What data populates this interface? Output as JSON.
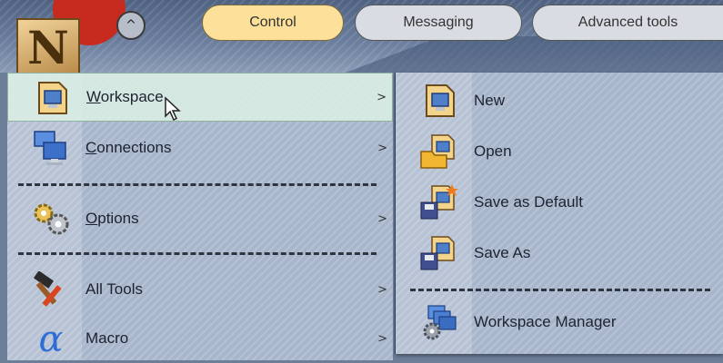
{
  "top": {
    "logo_letter": "N",
    "collapse_symbol": "^",
    "tabs": [
      {
        "label": "Control"
      },
      {
        "label": "Messaging"
      },
      {
        "label": "Advanced tools"
      }
    ]
  },
  "main_menu": {
    "items": [
      {
        "label": "Workspace",
        "icon": "workspace-icon",
        "arrow": ">"
      },
      {
        "label": "Connections",
        "icon": "connections-icon",
        "arrow": ">"
      },
      {
        "label": "Options",
        "icon": "gears-icon",
        "arrow": ">"
      },
      {
        "label": "All Tools",
        "icon": "tools-icon",
        "arrow": ">"
      },
      {
        "label": "Macro",
        "icon": "alpha-icon",
        "arrow": ">"
      }
    ]
  },
  "sub_menu": {
    "items": [
      {
        "label": "New",
        "icon": "new-workspace-icon"
      },
      {
        "label": "Open",
        "icon": "open-folder-icon"
      },
      {
        "label": "Save as Default",
        "icon": "save-default-icon"
      },
      {
        "label": "Save As",
        "icon": "save-as-icon"
      },
      {
        "label": "Workspace Manager",
        "icon": "workspace-manager-icon"
      }
    ]
  },
  "colors": {
    "active_tab": "#fde09a",
    "hover_row": "#dcf0e4",
    "menu_bg": "#a8b6cc"
  }
}
